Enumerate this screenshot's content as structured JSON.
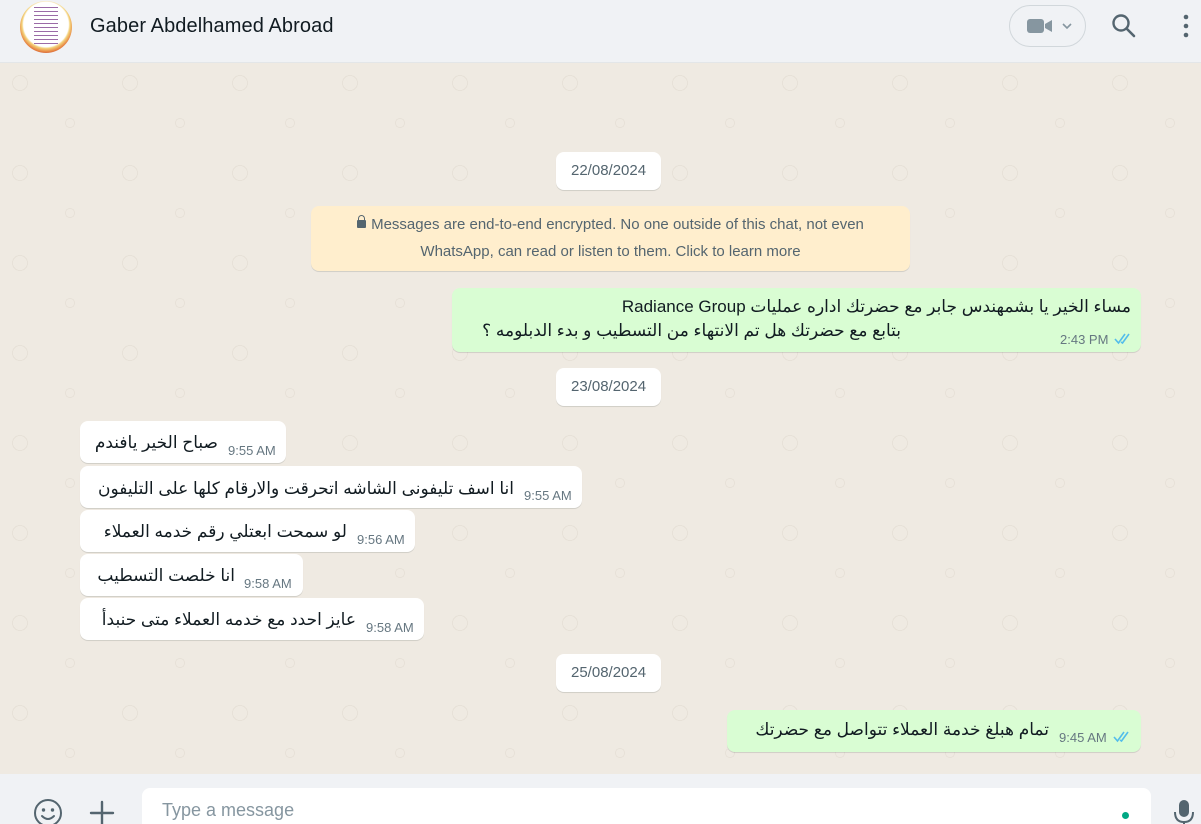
{
  "header": {
    "contact_name": "Gaber Abdelhamed Abroad",
    "icons": [
      "video-call-icon",
      "chevron-down-icon",
      "search-icon",
      "menu-icon"
    ]
  },
  "chat": {
    "dates": [
      "22/08/2024",
      "23/08/2024",
      "25/08/2024"
    ],
    "encryption_notice": {
      "line1": "Messages are end-to-end encrypted. No one outside of this chat, not even",
      "line2": "WhatsApp, can read or listen to them. Click to learn more"
    },
    "messages": [
      {
        "direction": "outgoing",
        "line1": "مساء الخير يا بشمهندس جابر مع  حضرتك اداره عمليات Radiance Group",
        "line2": "بتابع مع حضرتك هل تم الانتهاء من التسطيب و بدء الدبلومه ؟",
        "time": "2:43 PM",
        "status": "read"
      },
      {
        "direction": "incoming",
        "text": "صباح الخير يافندم",
        "time": "9:55 AM"
      },
      {
        "direction": "incoming",
        "text": "انا اسف تليفونى الشاشه اتحرقت والارقام كلها على التليفون",
        "time": "9:55 AM"
      },
      {
        "direction": "incoming",
        "text": "لو سمحت ابعتلي  رقم خدمه العملاء",
        "time": "9:56 AM"
      },
      {
        "direction": "incoming",
        "text": "انا خلصت التسطيب",
        "time": "9:58 AM"
      },
      {
        "direction": "incoming",
        "text": "عايز احدد مع خدمه العملاء متى حنبدأ",
        "time": "9:58 AM"
      },
      {
        "direction": "outgoing",
        "text": "تمام هبلغ خدمة العملاء تتواصل مع حضرتك",
        "time": "9:45 AM",
        "status": "read"
      }
    ]
  },
  "footer": {
    "placeholder": "Type a message",
    "icons": [
      "emoji-icon",
      "plus-icon",
      "microphone-icon"
    ]
  },
  "colors": {
    "outgoing_bubble": "#d9fdd3",
    "incoming_bubble": "#ffffff",
    "chat_background": "#efeae2",
    "encryption_notice_bg": "#ffeecd",
    "read_ticks": "#53bdeb",
    "accent": "#00a884"
  }
}
